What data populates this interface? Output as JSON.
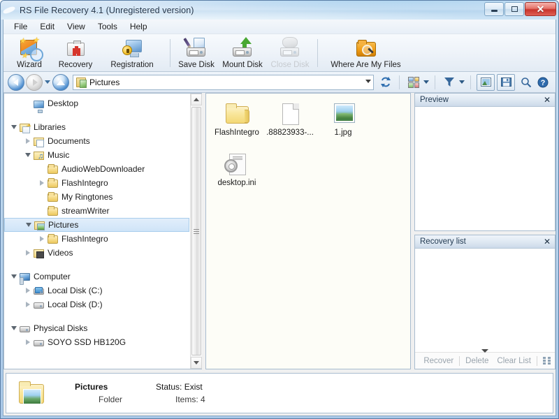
{
  "window": {
    "title": "RS File Recovery 4.1 (Unregistered version)",
    "app_icon": "globe-icon",
    "minimize_label": "",
    "maximize_label": "",
    "close_label": "✕",
    "accent_blue": "#2b6bb0",
    "titlebar_text_color": "#20344a"
  },
  "menubar": {
    "items": [
      {
        "label": "File"
      },
      {
        "label": "Edit"
      },
      {
        "label": "View"
      },
      {
        "label": "Tools"
      },
      {
        "label": "Help"
      }
    ]
  },
  "toolbar": {
    "buttons": [
      {
        "label": "Wizard",
        "icon": "wizard-icon",
        "disabled": false
      },
      {
        "label": "Recovery",
        "icon": "first-aid-kit-icon",
        "disabled": false
      },
      {
        "label": "Registration",
        "icon": "registration-lock-icon",
        "disabled": false
      },
      {
        "label": "Save Disk",
        "icon": "save-disk-icon",
        "disabled": false
      },
      {
        "label": "Mount Disk",
        "icon": "mount-disk-icon",
        "disabled": false
      },
      {
        "label": "Close Disk",
        "icon": "close-disk-icon",
        "disabled": true
      },
      {
        "label": "Where Are My Files",
        "icon": "folder-search-icon",
        "disabled": false
      }
    ]
  },
  "addressbar": {
    "back_icon": "back-arrow-icon",
    "forward_icon": "forward-arrow-icon",
    "history_icon": "history-dropdown-icon",
    "up_icon": "up-arrow-icon",
    "path_icon": "pictures-folder-icon",
    "path_value": "Pictures",
    "path_placeholder": "Pictures",
    "dropdown_icon": "chevron-down-icon",
    "refresh_icon": "refresh-icon",
    "view_icon": "view-mode-icon",
    "view_caret_icon": "chevron-down-icon",
    "filter_icon": "filter-funnel-icon",
    "filter_caret_icon": "chevron-down-icon",
    "preview_toggle_icon": "preview-pane-icon",
    "save_icon": "save-icon",
    "search_icon": "search-icon",
    "help_icon": "help-icon"
  },
  "tree": {
    "items": [
      {
        "label": "Desktop",
        "icon": "desktop-icon",
        "indent": 1,
        "twisty": "none",
        "selected": false
      },
      {
        "label": "",
        "icon": "gap",
        "indent": 0,
        "twisty": "none",
        "selected": false
      },
      {
        "label": "Libraries",
        "icon": "libraries-icon",
        "indent": 0,
        "twisty": "open",
        "selected": false
      },
      {
        "label": "Documents",
        "icon": "documents-folder-icon",
        "indent": 1,
        "twisty": "closed",
        "selected": false
      },
      {
        "label": "Music",
        "icon": "music-folder-icon",
        "indent": 1,
        "twisty": "open",
        "selected": false
      },
      {
        "label": "AudioWebDownloader",
        "icon": "folder-icon",
        "indent": 2,
        "twisty": "none",
        "selected": false
      },
      {
        "label": "FlashIntegro",
        "icon": "folder-icon",
        "indent": 2,
        "twisty": "closed",
        "selected": false
      },
      {
        "label": "My Ringtones",
        "icon": "folder-icon",
        "indent": 2,
        "twisty": "none",
        "selected": false
      },
      {
        "label": "streamWriter",
        "icon": "folder-icon",
        "indent": 2,
        "twisty": "none",
        "selected": false
      },
      {
        "label": "Pictures",
        "icon": "pictures-folder-icon",
        "indent": 1,
        "twisty": "open",
        "selected": true
      },
      {
        "label": "FlashIntegro",
        "icon": "folder-icon",
        "indent": 2,
        "twisty": "closed",
        "selected": false
      },
      {
        "label": "Videos",
        "icon": "videos-folder-icon",
        "indent": 1,
        "twisty": "closed",
        "selected": false
      },
      {
        "label": "",
        "icon": "gap",
        "indent": 0,
        "twisty": "none",
        "selected": false
      },
      {
        "label": "Computer",
        "icon": "computer-icon",
        "indent": 0,
        "twisty": "open",
        "selected": false
      },
      {
        "label": "Local Disk (C:)",
        "icon": "system-drive-icon",
        "indent": 1,
        "twisty": "closed",
        "selected": false
      },
      {
        "label": "Local Disk (D:)",
        "icon": "drive-icon",
        "indent": 1,
        "twisty": "closed",
        "selected": false
      },
      {
        "label": "",
        "icon": "gap",
        "indent": 0,
        "twisty": "none",
        "selected": false
      },
      {
        "label": "Physical Disks",
        "icon": "drive-icon",
        "indent": 0,
        "twisty": "open",
        "selected": false
      },
      {
        "label": "SOYO SSD HB120G",
        "icon": "drive-icon",
        "indent": 1,
        "twisty": "closed",
        "selected": false
      }
    ],
    "scrollbar": {
      "up_icon": "scroll-up-icon",
      "down_icon": "scroll-down-icon"
    }
  },
  "files": {
    "items": [
      {
        "name": "FlashIntegro",
        "type": "folder"
      },
      {
        "name": ".88823933-...",
        "type": "document"
      },
      {
        "name": "1.jpg",
        "type": "image"
      },
      {
        "name": "desktop.ini",
        "type": "ini"
      }
    ]
  },
  "preview_panel": {
    "title": "Preview",
    "close_label": "✕"
  },
  "recovery_panel": {
    "title": "Recovery list",
    "close_label": "✕",
    "actions": [
      {
        "label": "Recover"
      },
      {
        "label": "Delete"
      },
      {
        "label": "Clear List"
      }
    ],
    "grid_icon": "list-view-icon",
    "expander_icon": "collapse-caret-icon"
  },
  "statusbar": {
    "icon": "pictures-folder-icon",
    "name": "Pictures",
    "kind": "Folder",
    "status_label": "Status: Exist",
    "items_label": "Items: 4"
  }
}
